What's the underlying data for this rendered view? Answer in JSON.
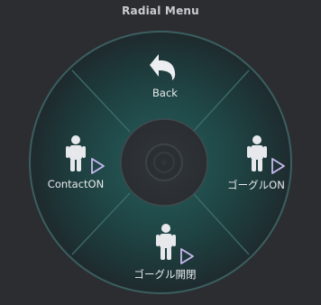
{
  "title": "Radial Menu",
  "items": [
    {
      "id": "up",
      "label": "Back",
      "icon": "back-arrow-icon"
    },
    {
      "id": "left",
      "label": "ContactON",
      "icon": "person-icon",
      "submenu_icon": "submenu-arrow-icon"
    },
    {
      "id": "right",
      "label": "ゴーグルON",
      "icon": "person-icon",
      "submenu_icon": "submenu-arrow-icon"
    },
    {
      "id": "down",
      "label": "ゴーグル開閉",
      "icon": "person-icon",
      "submenu_icon": "submenu-arrow-icon"
    }
  ],
  "colors": {
    "background": "#2b2d31",
    "ring_fill": "#1c2a2d",
    "ring_edge": "#3a6f6b",
    "accent": "#2f7f78",
    "icon": "#e6e8ec",
    "submenu_arrow": "#b9a8e6"
  }
}
